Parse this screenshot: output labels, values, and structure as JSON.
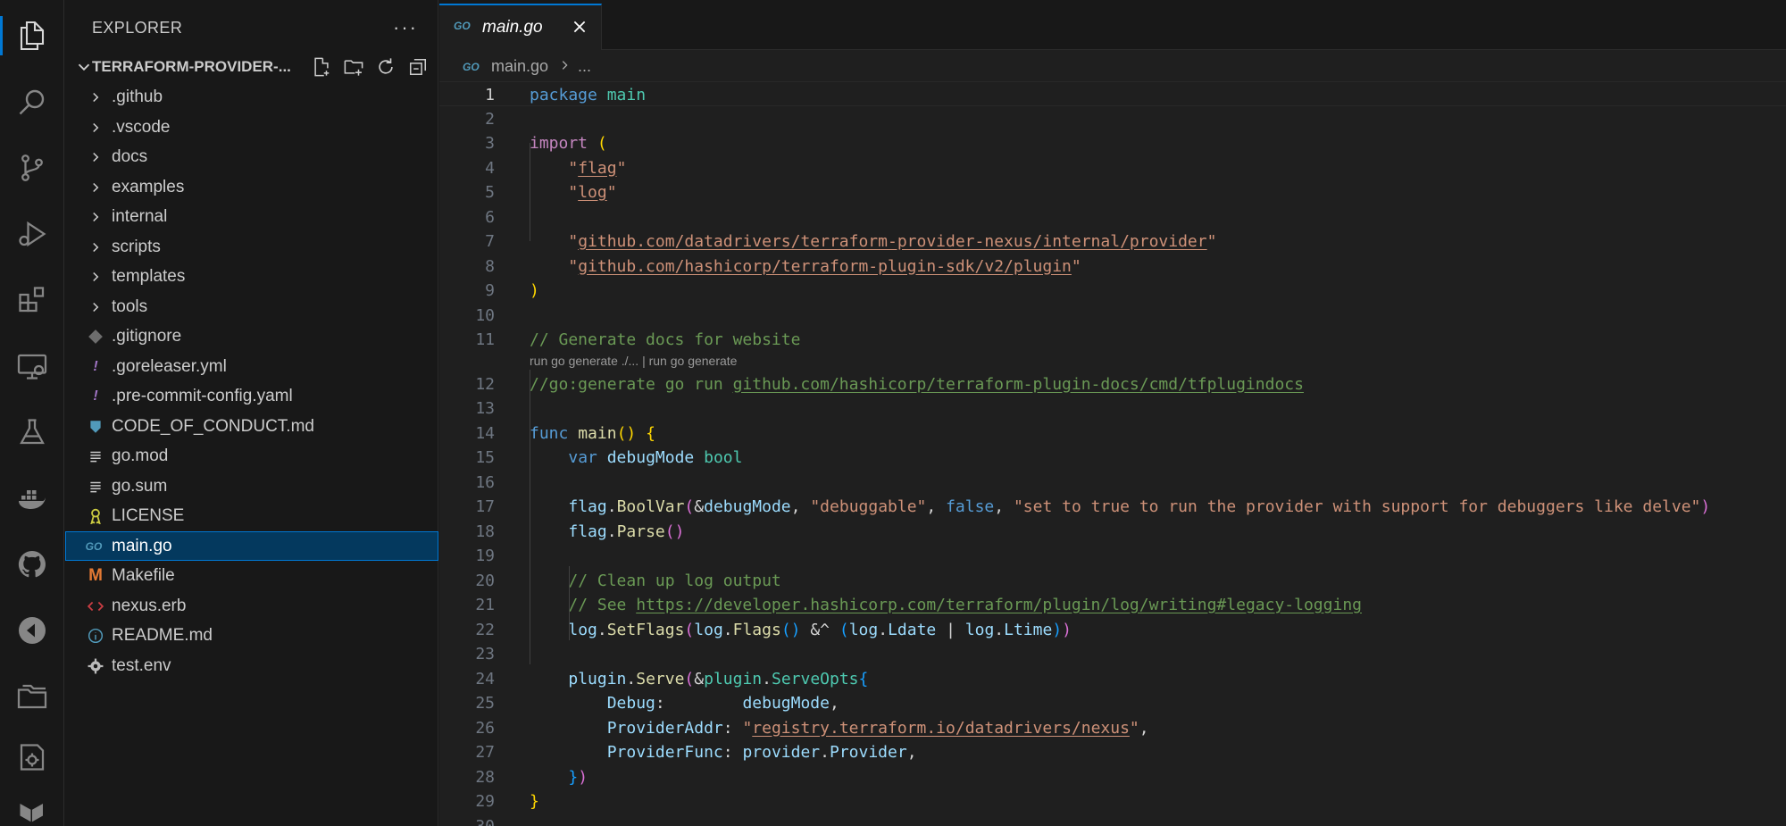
{
  "sidebar": {
    "header": "EXPLORER",
    "more": "···",
    "section_title": "TERRAFORM-PROVIDER-...",
    "tree": [
      {
        "label": ".github",
        "kind": "folder"
      },
      {
        "label": ".vscode",
        "kind": "folder"
      },
      {
        "label": "docs",
        "kind": "folder"
      },
      {
        "label": "examples",
        "kind": "folder"
      },
      {
        "label": "internal",
        "kind": "folder"
      },
      {
        "label": "scripts",
        "kind": "folder"
      },
      {
        "label": "templates",
        "kind": "folder"
      },
      {
        "label": "tools",
        "kind": "folder"
      },
      {
        "label": ".gitignore",
        "kind": "git-icon"
      },
      {
        "label": ".goreleaser.yml",
        "kind": "yaml-icon"
      },
      {
        "label": ".pre-commit-config.yaml",
        "kind": "yaml-icon"
      },
      {
        "label": "CODE_OF_CONDUCT.md",
        "kind": "markdown-icon"
      },
      {
        "label": "go.mod",
        "kind": "lines-icon"
      },
      {
        "label": "go.sum",
        "kind": "lines-icon"
      },
      {
        "label": "LICENSE",
        "kind": "license-icon"
      },
      {
        "label": "main.go",
        "kind": "go-icon"
      },
      {
        "label": "Makefile",
        "kind": "makefile-icon"
      },
      {
        "label": "nexus.erb",
        "kind": "code-icon"
      },
      {
        "label": "README.md",
        "kind": "info-icon"
      },
      {
        "label": "test.env",
        "kind": "gear-icon"
      }
    ]
  },
  "editor": {
    "tab_label": "main.go",
    "go_badge": "GO",
    "breadcrumb_file": "main.go",
    "breadcrumb_more": "...",
    "codelens": "run go generate ./... | run go generate",
    "line_numbers": [
      "1",
      "2",
      "3",
      "4",
      "5",
      "6",
      "7",
      "8",
      "9",
      "10",
      "11",
      "12",
      "13",
      "14",
      "15",
      "16",
      "17",
      "18",
      "19",
      "20",
      "21",
      "22",
      "23",
      "24",
      "25",
      "26",
      "27",
      "28",
      "29",
      "30"
    ]
  },
  "colors": {
    "accent": "#0078d4",
    "selection": "#04395e",
    "keyword": "#569cd6",
    "string": "#ce9178",
    "comment": "#6a9955",
    "function": "#dcdcaa",
    "type": "#4ec9b0"
  }
}
